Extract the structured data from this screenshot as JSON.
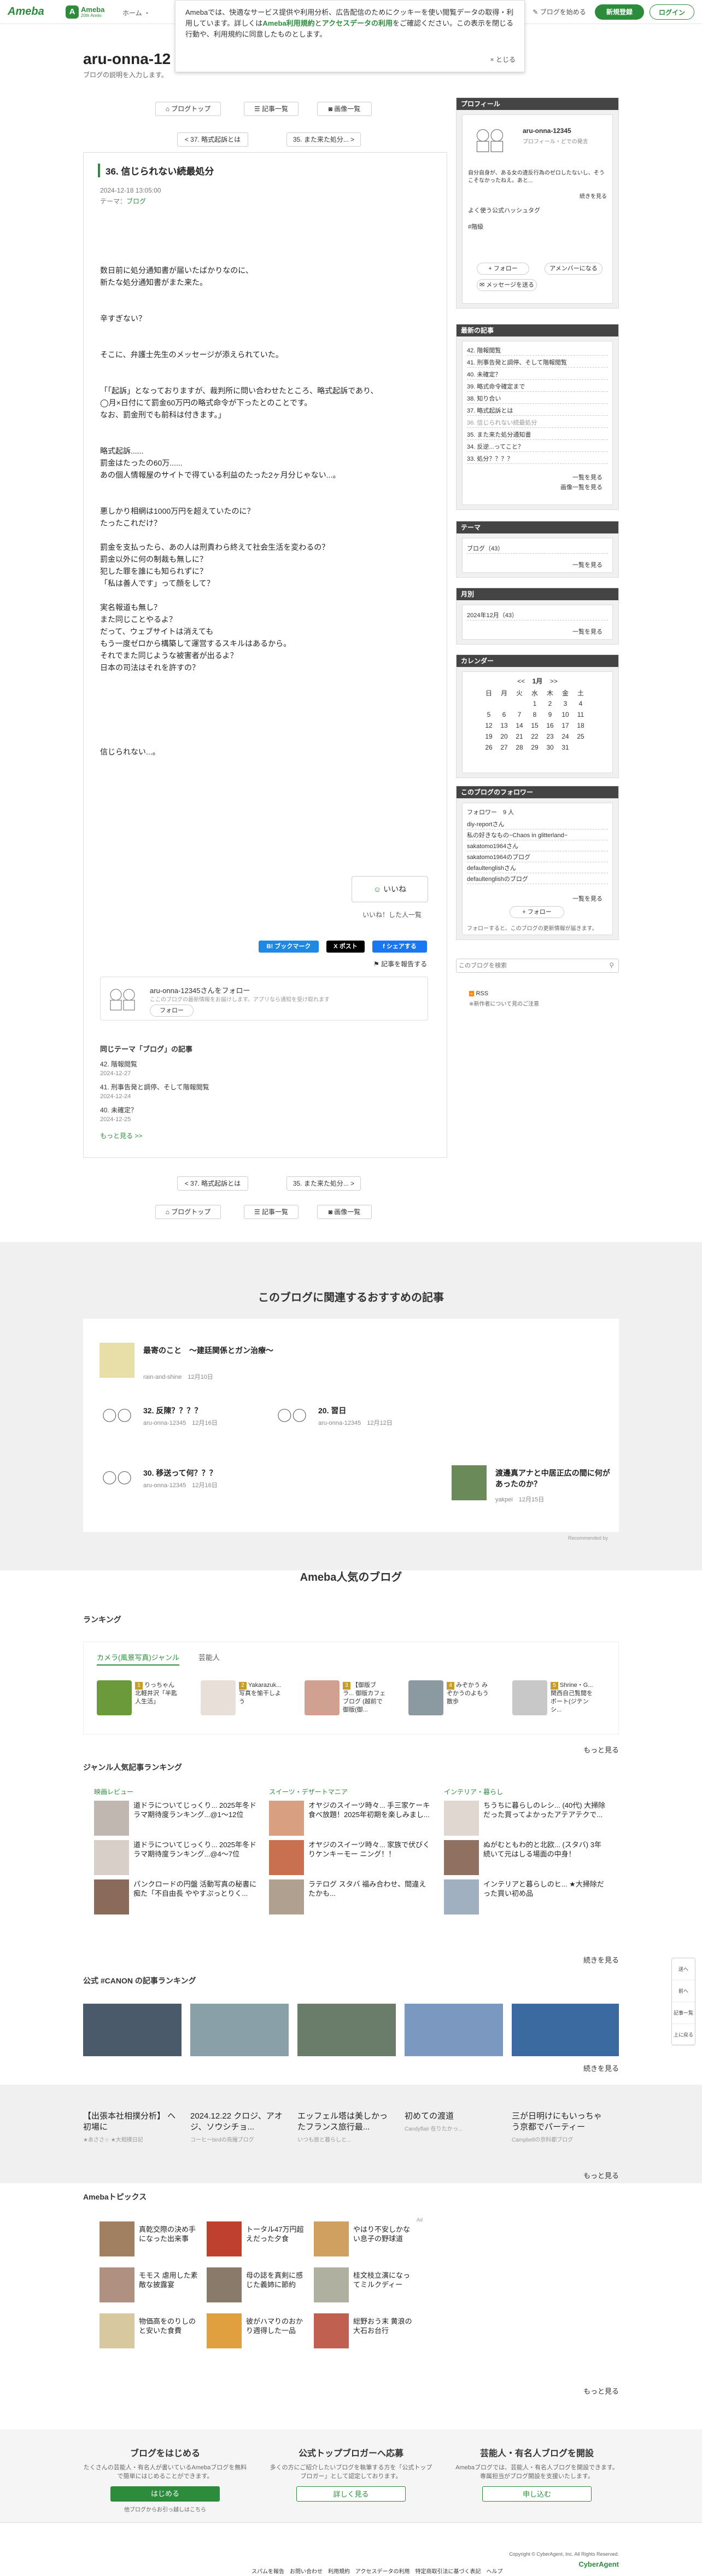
{
  "header": {
    "logo": "Ameba",
    "logo2_main": "Ameba",
    "logo2_sub": "20th Anniv.",
    "breadcrumb": "ホーム ・",
    "start_blog": "ブログを始める",
    "register": "新規登録",
    "login": "ログイン"
  },
  "cookie": {
    "text_1": "Amebaでは、快適なサービス提供や利用分析、広告配信のためにクッキーを使い閲覧データの取得・利用しています。詳しくは",
    "link_1": "Ameba利用規約",
    "text_2": "と",
    "link_2": "アクセスデータの利用",
    "text_3": "をご確認ください。この表示を閉じる行動や、利用規約に同意したものとします。",
    "close": "とじる"
  },
  "blog": {
    "title": "aru-onna-12",
    "description": "ブログの説明を入力します。"
  },
  "toolbar": {
    "top": "ブログトップ",
    "list": "記事一覧",
    "images": "画像一覧"
  },
  "nav": {
    "prev": "< 37. 略式起訴とは",
    "next": "35. また来た処分... >",
    "prev2": "< 37. 略式起訴とは",
    "next2": "35. また来た処分... >"
  },
  "article": {
    "title": "36. 信じられない続最処分",
    "date": "2024-12-18 13:05:00",
    "theme_label": "テーマ：",
    "theme": "ブログ",
    "body": [
      "",
      "",
      "数日前に処分通知書が届いたばかりなのに、",
      "新たな処分通知書がまた来た。",
      "",
      "",
      "辛すぎない？",
      "",
      "",
      "そこに、弁護士先生のメッセージが添えられていた。",
      "",
      "",
      "「「起訴」となっておりますが、裁判所に問い合わせたところ、略式起訴であり、",
      "◯月×日付にて罰金60万円の略式命令が下ったとのことです。",
      "なお、罰金刑でも前科は付きます。」",
      "",
      "",
      "略式起訴......",
      "罰金はたったの60万......",
      "あの個人情報屋のサイトで得ている利益のたった2ヶ月分じゃない...。",
      "",
      "",
      "悪しかり相網は1000万円を超えていたのに？",
      "たったこれだけ？",
      "",
      "罰金を支払ったら、あの人は刑責わら終えて社会生活を変わるの？",
      "罰金以外に何の制裁も無しに？",
      "犯した罪を誰にも知られずに？",
      "「私は善人です」って顔をして？",
      "",
      "実名報道も無し？",
      "また同じことやるよ？",
      "だって、ウェブサイトは消えても",
      "もう一度ゼロから構築して運営するスキルはあるから。",
      "それでまた同じような被害者が出るよ？",
      "日本の司法はそれを許すの？",
      "",
      "",
      "",
      "",
      "",
      "",
      "信じられない...。"
    ],
    "like": "いいね",
    "like_count": "いいね！した人一覧",
    "reblog": "記事を報告する",
    "share_bookmark": "B! ブックマーク",
    "share_x": "X ポスト",
    "share_fb": "f シェアする",
    "follow_name": "aru-onna-12345さんをフォロー",
    "follow_sub": "ここのブログの最新情報をお届けします。アプリなら通知を受け取れます",
    "follow_btn": "フォロー",
    "same_theme": "同じテーマ「ブログ」の記事",
    "same_items": [
      {
        "t": "42. 階報閲覧",
        "d": "2024-12-27"
      },
      {
        "t": "41. 刑事告発と調停、そして階報閲覧",
        "d": "2024-12-24"
      },
      {
        "t": "40. 未確定？",
        "d": "2024-12-25"
      }
    ],
    "more": "もっと見る >>"
  },
  "sidebar": {
    "profile_h": "プロフィール",
    "profile_name": "aru-onna-12345",
    "profile_sub": "プロフィール・どでの発言",
    "profile_text": "自分自身が、ある女の違反行為のゼロしたないし、そうこそなかったねえ。あと...",
    "profile_more": "続きを見る",
    "profile_tag": "よく使う公式ハッシュタグ",
    "profile_tag2": "#階級",
    "follow": "+ フォロー",
    "amember": "アメンバーになる",
    "message": "メッセージを送る",
    "recent_h": "最新の記事",
    "recent": [
      "42. 階報閲覧",
      "41. 刑事告発と調停、そして階報閲覧",
      "40. 未確定？",
      "39. 略式命令確定まで",
      "38. 知り合い",
      "37. 略式起訴とは",
      "36. 信じられない続最処分",
      "35. また来た処分通知書",
      "34. 反逆...ってこと？",
      "33. 処分？？？？"
    ],
    "recent_more": "一覧を見る",
    "recent_more2": "画像一覧を見る",
    "theme_h": "テーマ",
    "theme_item": "ブログ（43）",
    "theme_more": "一覧を見る",
    "month_h": "月別",
    "month_item": "2024年12月（43）",
    "month_more": "一覧を見る",
    "cal_h": "カレンダー",
    "cal_title": "1月",
    "cal_prev": "<<",
    "cal_next": ">>",
    "cal_days": [
      "日",
      "月",
      "火",
      "水",
      "木",
      "金",
      "土"
    ],
    "cal_rows": [
      [
        "",
        "",
        "",
        "1",
        "2",
        "3",
        "4"
      ],
      [
        "5",
        "6",
        "7",
        "8",
        "9",
        "10",
        "11"
      ],
      [
        "12",
        "13",
        "14",
        "15",
        "16",
        "17",
        "18"
      ],
      [
        "19",
        "20",
        "21",
        "22",
        "23",
        "24",
        "25"
      ],
      [
        "26",
        "27",
        "28",
        "29",
        "30",
        "31",
        ""
      ]
    ],
    "followers_h": "このブログのフォロワー",
    "followers_count": "フォロワー　9 人",
    "followers": [
      "diy-reportさん",
      "私の好きなもの~Chaos in glitterland~",
      "sakatomo1964さん",
      "sakatomo1964のブログ",
      "defaultenglishさん",
      "defaultenglishのブログ"
    ],
    "followers_more": "一覧を見る",
    "follow2": "+ フォロー",
    "follow_note": "フォローすると、このブログの更新情報が届きます。",
    "search_placeholder": "このブログを検索",
    "rss": "RSS",
    "rss_note": "※新作者について見のご注意"
  },
  "recommend": {
    "title": "このブログに関連するおすすめの記事",
    "items": [
      {
        "t": "最寄のこと　〜建廷関係とガン治療〜",
        "a": "rain-and-shine",
        "d": "12月10日"
      },
      {
        "t": "32. 反陳？？？？",
        "a": "aru-onna-12345",
        "d": "12月16日"
      },
      {
        "t": "20. 習日",
        "a": "aru-onna-12345",
        "d": "12月12日"
      },
      {
        "t": "30. 移送って何？？？",
        "a": "aru-onna-12345",
        "d": "12月16日"
      },
      {
        "t": "渡邊真アナと中居正広の間に何があったのか？",
        "a": "yakpei",
        "d": "12月15日"
      }
    ],
    "credit": "Recommended by"
  },
  "popular": {
    "title": "Ameba人気のブログ",
    "ranking_h": "ランキング",
    "tabs": [
      "カメラ(風景写真)ジャンル",
      "芸能人"
    ],
    "rank": [
      {
        "n": "1",
        "t": "りっちゃん 北軽井沢「半匙人生活」"
      },
      {
        "n": "2",
        "t": "Yakarazuk... 写真を愉干しよう"
      },
      {
        "n": "3",
        "t": "【御版ブラ... 御版カフェブログ (越前で御版(御..."
      },
      {
        "n": "4",
        "t": "みぞかう みぞかうのよもう散歩"
      },
      {
        "n": "5",
        "t": "Shrine・G... 関西自己覧閲を ボート(ジテンシ..."
      }
    ],
    "rank_more": "もっと見る",
    "genre_h": "ジャンル人気記事ランキング",
    "genres": [
      {
        "h": "映画レビュー",
        "items": [
          "道ドラについてじっくり... 2025年冬ドラマ期待度ランキング...@1〜12位",
          "道ドラについてじっくり... 2025年冬ドラマ期待度ランキング...@4〜7位",
          "パンクロードの円盤 活動写真の秘書に痴た「不自由長 ややすぷっとりく..."
        ]
      },
      {
        "h": "スイーツ・デザートマニア",
        "items": [
          "オヤジのスイーツ時々... 手三家ケーキ食べ放題！2025年初期を楽しみまし...",
          "オヤジのスイーツ時々... 家族で伏びくりケンキーモー ニング！！",
          "ラテログ スタバ 福み合わせ、間違えたかも..."
        ]
      },
      {
        "h": "インテリア・暮らし",
        "items": [
          "ちうちに暮らしのレシ... (40代) 大掃除だった買ってよかったアテアテクで...",
          "ぬがむともわ的と北欧... (スタバ) 3年続いて元はしる場面の中身！",
          "インテリアと暮らしのヒ... ★大掃除だった買い初め品"
        ]
      }
    ],
    "genre_more": "続きを見る",
    "canon_h": "公式 #CANON の記事ランキング",
    "canon_more": "続きを見る",
    "news": [
      {
        "t": "【出張本社相撲分析】 ヘ初場に",
        "s": "★あささ☆ ★大相撲日記"
      },
      {
        "t": "2024.12.22 クロジ、アオジ、ソウシチョ...",
        "s": "コーヒーbirdの鳥撮ブログ"
      },
      {
        "t": "エッフェル塔は美しかったフランス旅行最...",
        "s": "いつも旅と暮らしと..."
      },
      {
        "t": "初めての渡道",
        "s": "Candyflair 在りたかっ..."
      },
      {
        "t": "三が日明けにもいっちゃう京都でパーティー",
        "s": "Campbellの京科都ブログ"
      }
    ],
    "news_more": "もっと見る",
    "topics_h": "Amebaトピックス",
    "topics": [
      "真乾交際の決め手になった出来事",
      "トータル47万円超えだった夕食",
      "やはり不安しかない息子の野球道",
      "モモス 虐用した素敵な披露宴",
      "母の誌を真剣に感じた義姉に節約",
      "桂文枝立演になってミルクディー",
      "物価高をのりしのと安いた食費",
      "彼がハマりのおかり週得した一品",
      "総野おう末 黄浪の大石お台行",
      "Ad"
    ],
    "topics_more": "もっと見る"
  },
  "footer": {
    "cta1_h": "ブログをはじめる",
    "cta1_d": "たくさんの芸能人・有名人が書いているAmebaブログを無料で簡単にはじめることができます。",
    "cta1_b": "はじめる",
    "cta1_s": "他ブログからお引っ越しはこちら",
    "cta2_h": "公式トップブロガーへ応募",
    "cta2_d": "多くの方にご紹介したいブログを執筆する方を「公式トップブロガー」として認定しております。",
    "cta2_b": "詳しく見る",
    "cta3_h": "芸能人・有名人ブログを開設",
    "cta3_d": "Amebaブログでは、芸能人・有名人ブログを開設できます。専属担当がブログ開設を支援いたします。",
    "cta3_b": "申し込む",
    "links": [
      "スパムを報告",
      "お問い合わせ",
      "利用規約",
      "アクセスデータの利用",
      "特定商取引法に基づく表記",
      "ヘルプ"
    ],
    "copyright": "Copyright © CyberAgent, Inc. All Rights Reserved.",
    "brand": "CyberAgent",
    "float": [
      "送へ",
      "前へ",
      "記事一覧",
      "上に戻る"
    ]
  },
  "colors": {
    "brand": "#2d8c3c",
    "sidebar_head": "#444444",
    "bookmark": "#1e88e5",
    "x": "#000000",
    "facebook": "#1877f2"
  }
}
